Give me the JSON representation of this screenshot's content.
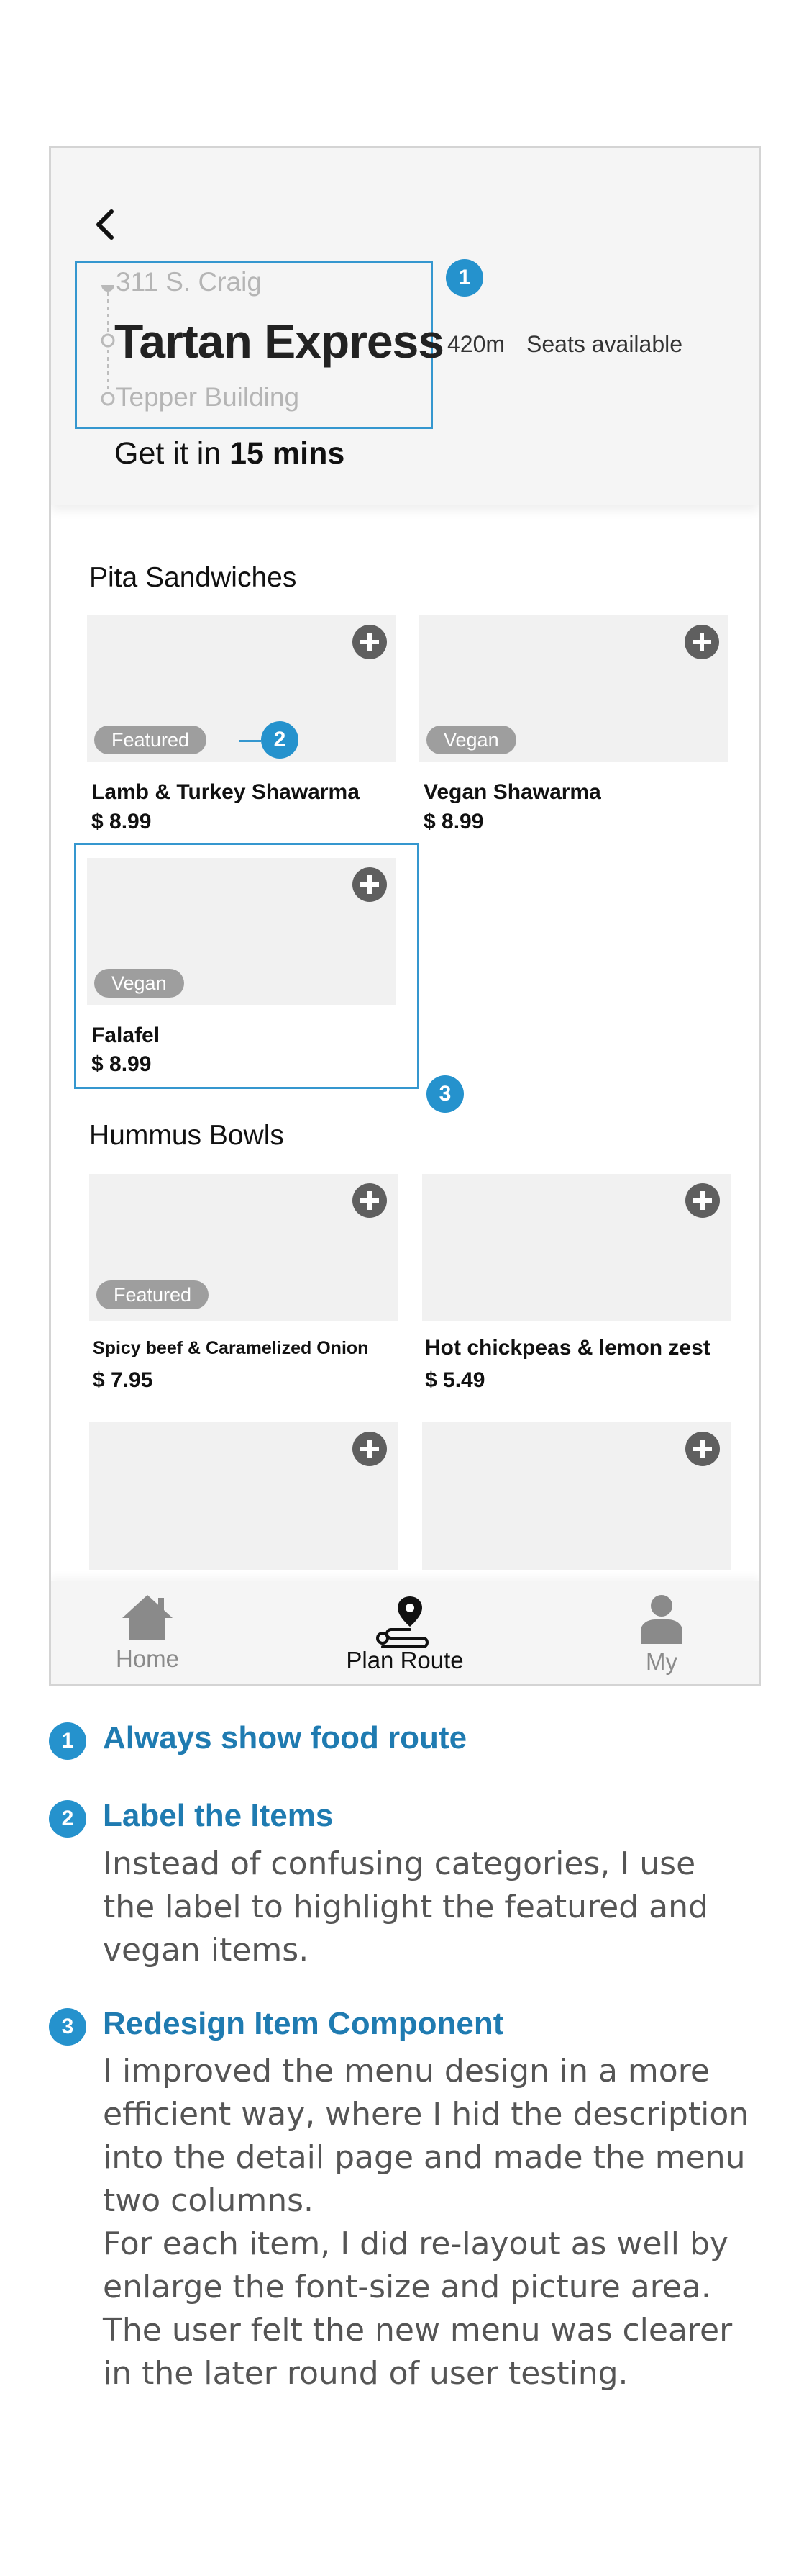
{
  "header": {
    "origin": "311 S. Craig",
    "restaurant": "Tartan Express",
    "destination": "Tepper Building",
    "distance": "420m",
    "seats": "Seats available",
    "eta_prefix": "Get it in",
    "eta_value": "15 mins"
  },
  "sections": [
    {
      "title": "Pita Sandwiches",
      "items": [
        {
          "name": "Lamb & Turkey Shawarma",
          "price": "$ 8.99",
          "tag": "Featured"
        },
        {
          "name": "Vegan Shawarma",
          "price": "$ 8.99",
          "tag": "Vegan"
        },
        {
          "name": "Falafel",
          "price": "$ 8.99",
          "tag": "Vegan"
        }
      ]
    },
    {
      "title": "Hummus Bowls",
      "items": [
        {
          "name": "Spicy beef & Caramelized Onion",
          "price": "$ 7.95",
          "tag": "Featured"
        },
        {
          "name": "Hot chickpeas & lemon zest",
          "price": "$ 5.49",
          "tag": ""
        }
      ]
    }
  ],
  "nav": {
    "home": "Home",
    "plan_route": "Plan Route",
    "my": "My"
  },
  "annotations": {
    "n1": "1",
    "n2": "2",
    "n3": "3"
  },
  "notes": [
    {
      "num": "1",
      "title": "Always show food route",
      "paragraphs": []
    },
    {
      "num": "2",
      "title": "Label the Items",
      "paragraphs": [
        "Instead of confusing categories, I use the label to highlight the featured and vegan items."
      ]
    },
    {
      "num": "3",
      "title": "Redesign Item Component",
      "paragraphs": [
        "I improved the menu design in a more efficient way, where I hid the description into the detail page and made the menu two columns.",
        "For each item, I did re-layout as well by enlarge the font-size and picture area. The user felt the new menu was clearer in the later round of user testing."
      ]
    }
  ],
  "colors": {
    "annotation_blue": "#2592cd",
    "note_title_blue": "#1f7bb1",
    "tag_gray": "#9e9e9e"
  }
}
